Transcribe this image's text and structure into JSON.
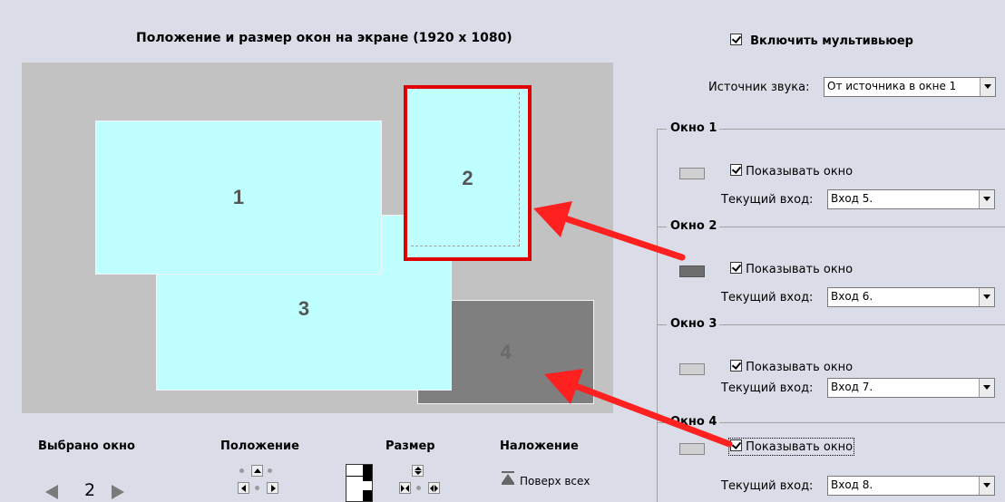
{
  "preview": {
    "title": "Положение и размер окон на экране (1920 x 1080)",
    "windows": [
      {
        "label": "1"
      },
      {
        "label": "2"
      },
      {
        "label": "3"
      },
      {
        "label": "4"
      }
    ],
    "selected_window": 2,
    "annotation_color": "#ff2020"
  },
  "settings": {
    "enable_label": "Включить мультивьюер",
    "enable_checked": true,
    "audio_label": "Источник звука:",
    "audio_value": "От источника в окне 1",
    "groups": [
      {
        "title": "Окно 1",
        "show_label": "Показывать окно",
        "show_checked": true,
        "input_label": "Текущий вход:",
        "input_value": "Вход 5."
      },
      {
        "title": "Окно 2",
        "show_label": "Показывать окно",
        "show_checked": true,
        "input_label": "Текущий вход:",
        "input_value": "Вход 6."
      },
      {
        "title": "Окно 3",
        "show_label": "Показывать окно",
        "show_checked": true,
        "input_label": "Текущий вход:",
        "input_value": "Вход 7."
      },
      {
        "title": "Окно 4",
        "show_label": "Показывать окно",
        "show_checked": true,
        "input_label": "Текущий вход:",
        "input_value": "Вход 8."
      }
    ]
  },
  "controls": {
    "selected_label": "Выбрано окно",
    "selected_value": "2",
    "position_label": "Положение",
    "size_label": "Размер",
    "overlay_label": "Наложение",
    "on_top_label": "Поверх всех"
  }
}
